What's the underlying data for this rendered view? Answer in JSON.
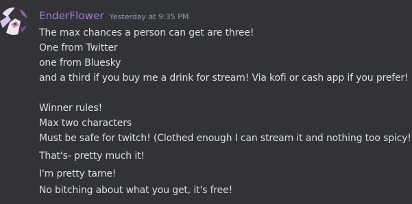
{
  "message": {
    "author": "EnderFlower",
    "author_color": "#a779d6",
    "timestamp": "Yesterday at 9:35 PM",
    "avatar_icon": "character-avatar-icon",
    "block1": [
      "The max chances a person can get are three!",
      "One from Twitter",
      "one from Bluesky",
      "and a third if you buy me a drink for stream! Via kofi or cash app if you prefer!"
    ],
    "block2": [
      "Winner rules!",
      "Max two characters",
      "Must be safe for twitch! (Clothed enough I can stream it and nothing too spicy!)"
    ],
    "followups": [
      "That's- pretty much it!",
      "I'm pretty tame!",
      "No bitching about what you get, it's free!"
    ]
  }
}
